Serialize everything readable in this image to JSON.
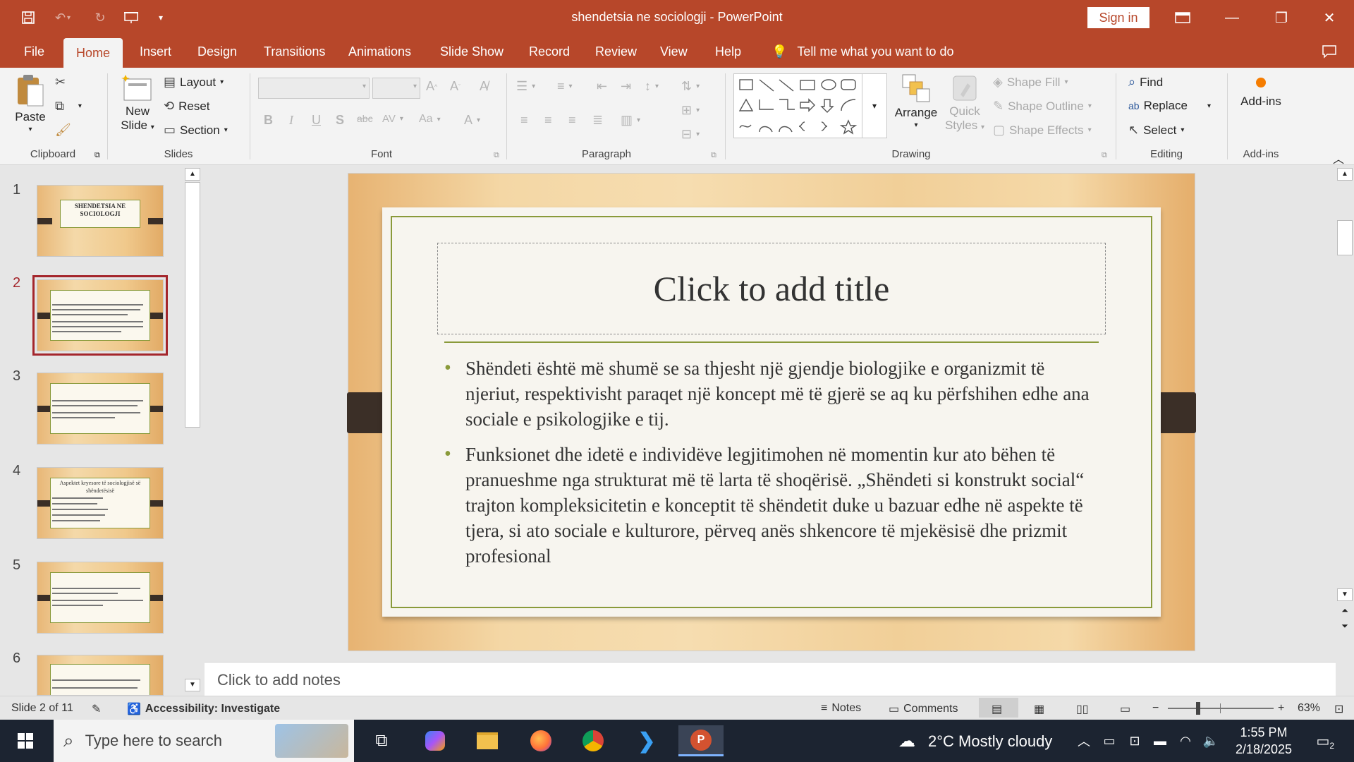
{
  "titlebar": {
    "doc_title": "shendetsia ne sociologji  -  PowerPoint",
    "sign_in": "Sign in"
  },
  "tabs": [
    "File",
    "Home",
    "Insert",
    "Design",
    "Transitions",
    "Animations",
    "Slide Show",
    "Record",
    "Review",
    "View",
    "Help"
  ],
  "tell_me": "Tell me what you want to do",
  "ribbon": {
    "clipboard": {
      "paste": "Paste",
      "label": "Clipboard"
    },
    "slides": {
      "new_slide_1": "New",
      "new_slide_2": "Slide",
      "layout": "Layout",
      "reset": "Reset",
      "section": "Section",
      "label": "Slides"
    },
    "font": {
      "label": "Font"
    },
    "paragraph": {
      "label": "Paragraph"
    },
    "drawing": {
      "arrange": "Arrange",
      "quick_styles_1": "Quick",
      "quick_styles_2": "Styles",
      "shape_fill": "Shape Fill",
      "shape_outline": "Shape Outline",
      "shape_effects": "Shape Effects",
      "label": "Drawing"
    },
    "editing": {
      "find": "Find",
      "replace": "Replace",
      "select": "Select",
      "label": "Editing"
    },
    "addins": {
      "button": "Add-ins",
      "label": "Add-ins"
    }
  },
  "thumbnails": [
    {
      "num": "1",
      "title": "SHENDETSIA NE SOCIOLOGJI"
    },
    {
      "num": "2",
      "title": ""
    },
    {
      "num": "3",
      "title": ""
    },
    {
      "num": "4",
      "title": "Aspektet kryesore të sociologjisë së shëndetësisë"
    },
    {
      "num": "5",
      "title": ""
    },
    {
      "num": "6",
      "title": ""
    }
  ],
  "slide": {
    "title_placeholder": "Click to add title",
    "bullet1": "Shëndeti është më shumë se sa thjesht një gjendje biologjike e organizmit të njeriut, respektivisht paraqet një koncept më të gjerë se aq ku përfshihen edhe ana sociale e psikologjike e tij.",
    "bullet2": " Funksionet dhe idetë e individëve legjitimohen në momentin kur ato bëhen të pranueshme nga strukturat më të larta të shoqërisë. „Shëndeti si konstrukt social“ trajton kompleksicitetin e konceptit të shëndetit duke u bazuar edhe në aspekte të tjera, si ato sociale e kulturore, përveq anës shkencore të mjekësisë dhe prizmit profesional"
  },
  "notes_placeholder": "Click to add notes",
  "status": {
    "slide_of": "Slide 2 of 11",
    "accessibility": "Accessibility: Investigate",
    "notes": "Notes",
    "comments": "Comments",
    "zoom": "63%"
  },
  "taskbar": {
    "search_placeholder": "Type here to search",
    "weather": "2°C  Mostly cloudy",
    "time": "1:55 PM",
    "date": "2/18/2025",
    "notif_count": "2"
  }
}
